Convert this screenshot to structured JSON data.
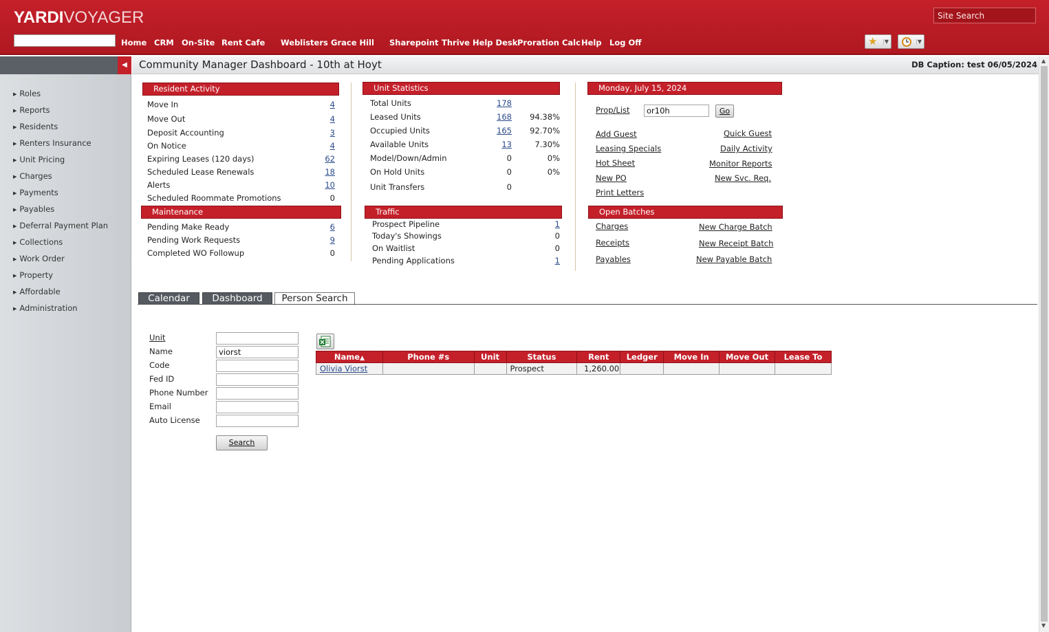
{
  "header": {
    "logo_bold": "YARDI",
    "logo_light": "VOYAGER",
    "site_search_placeholder": "Site Search",
    "nav": [
      "Home",
      "CRM",
      "On-Site",
      "Rent Cafe",
      "Weblisters",
      "Grace Hill",
      "Sharepoint",
      "Thrive Help Desk",
      "Proration Calc",
      "Help",
      "Log Off"
    ],
    "favorites_icon": "star-icon",
    "history_icon": "clock-icon"
  },
  "sidebar": {
    "items": [
      "Roles",
      "Reports",
      "Residents",
      "Renters Insurance",
      "Unit Pricing",
      "Charges",
      "Payments",
      "Payables",
      "Deferral Payment Plan",
      "Collections",
      "Work Order",
      "Property",
      "Affordable",
      "Administration"
    ]
  },
  "titlebar": {
    "title": "Community Manager Dashboard - 10th at Hoyt",
    "caption": "DB Caption: test 06/05/2024"
  },
  "resident_activity": {
    "title": "Resident Activity",
    "rows": [
      {
        "label": "Move In",
        "value": "4",
        "link": true
      },
      {
        "label": "Move Out",
        "value": "4",
        "link": true
      },
      {
        "label": "Deposit Accounting",
        "value": "3",
        "link": true
      },
      {
        "label": "On Notice",
        "value": "4",
        "link": true
      },
      {
        "label": "Expiring Leases (120 days)",
        "value": "62",
        "link": true
      },
      {
        "label": "Scheduled Lease Renewals",
        "value": "18",
        "link": true
      },
      {
        "label": "Alerts",
        "value": "10",
        "link": true
      },
      {
        "label": "Scheduled Roommate Promotions",
        "value": "0",
        "link": false
      }
    ]
  },
  "maintenance": {
    "title": "Maintenance",
    "rows": [
      {
        "label": "Pending Make Ready",
        "value": "6",
        "link": true
      },
      {
        "label": "Pending Work Requests",
        "value": "9",
        "link": true
      },
      {
        "label": "Completed WO Followup",
        "value": "0",
        "link": false
      }
    ]
  },
  "unit_statistics": {
    "title": "Unit Statistics",
    "rows": [
      {
        "label": "Total Units",
        "value": "178",
        "link": true,
        "pct": ""
      },
      {
        "label": "Leased Units",
        "value": "168",
        "link": true,
        "pct": "94.38%"
      },
      {
        "label": "Occupied Units",
        "value": "165",
        "link": true,
        "pct": "92.70%"
      },
      {
        "label": "Available Units",
        "value": "13",
        "link": true,
        "pct": "7.30%"
      },
      {
        "label": "Model/Down/Admin",
        "value": "0",
        "link": false,
        "pct": "0%"
      },
      {
        "label": "On Hold Units",
        "value": "0",
        "link": false,
        "pct": "0%"
      },
      {
        "label": "Unit Transfers",
        "value": "0",
        "link": false,
        "pct": ""
      }
    ]
  },
  "traffic": {
    "title": "Traffic",
    "rows": [
      {
        "label": "Prospect Pipeline",
        "value": "1",
        "link": true
      },
      {
        "label": "Today's Showings",
        "value": "0",
        "link": false
      },
      {
        "label": "On Waitlist",
        "value": "0",
        "link": false
      },
      {
        "label": "Pending Applications",
        "value": "1",
        "link": true
      }
    ]
  },
  "date_panel": {
    "title": "Monday, July 15, 2024",
    "prop_label": "Prop/List",
    "prop_value": "or10h",
    "go_label": "Go",
    "links_left": [
      "Add Guest",
      "Leasing Specials",
      "Hot Sheet",
      "New PO",
      "Print Letters"
    ],
    "links_right": [
      "Quick Guest",
      "Daily Activity",
      "Monitor Reports",
      "New Svc. Req."
    ]
  },
  "open_batches": {
    "title": "Open Batches",
    "rows": [
      {
        "left": "Charges",
        "right": "New Charge Batch"
      },
      {
        "left": "Receipts",
        "right": "New Receipt Batch"
      },
      {
        "left": "Payables",
        "right": "New Payable Batch"
      }
    ]
  },
  "tabs": [
    "Calendar",
    "Dashboard",
    "Person Search"
  ],
  "active_tab": "Person Search",
  "person_search": {
    "fields": [
      {
        "label": "Unit",
        "value": "",
        "link": true
      },
      {
        "label": "Name",
        "value": "viorst",
        "link": false
      },
      {
        "label": "Code",
        "value": "",
        "link": false
      },
      {
        "label": "Fed ID",
        "value": "",
        "link": false
      },
      {
        "label": "Phone Number",
        "value": "",
        "link": false
      },
      {
        "label": "Email",
        "value": "",
        "link": false
      },
      {
        "label": "Auto License",
        "value": "",
        "link": false
      }
    ],
    "search_label": "Search",
    "export_icon": "excel-export-icon",
    "grid": {
      "columns": [
        "Name",
        "Phone #s",
        "Unit",
        "Status",
        "Rent",
        "Ledger",
        "Move In",
        "Move Out",
        "Lease To"
      ],
      "sorted_column": "Name",
      "rows": [
        [
          "Olivia Viorst",
          "",
          "",
          "Prospect",
          "1,260.00",
          "",
          "",
          "",
          ""
        ]
      ]
    }
  }
}
